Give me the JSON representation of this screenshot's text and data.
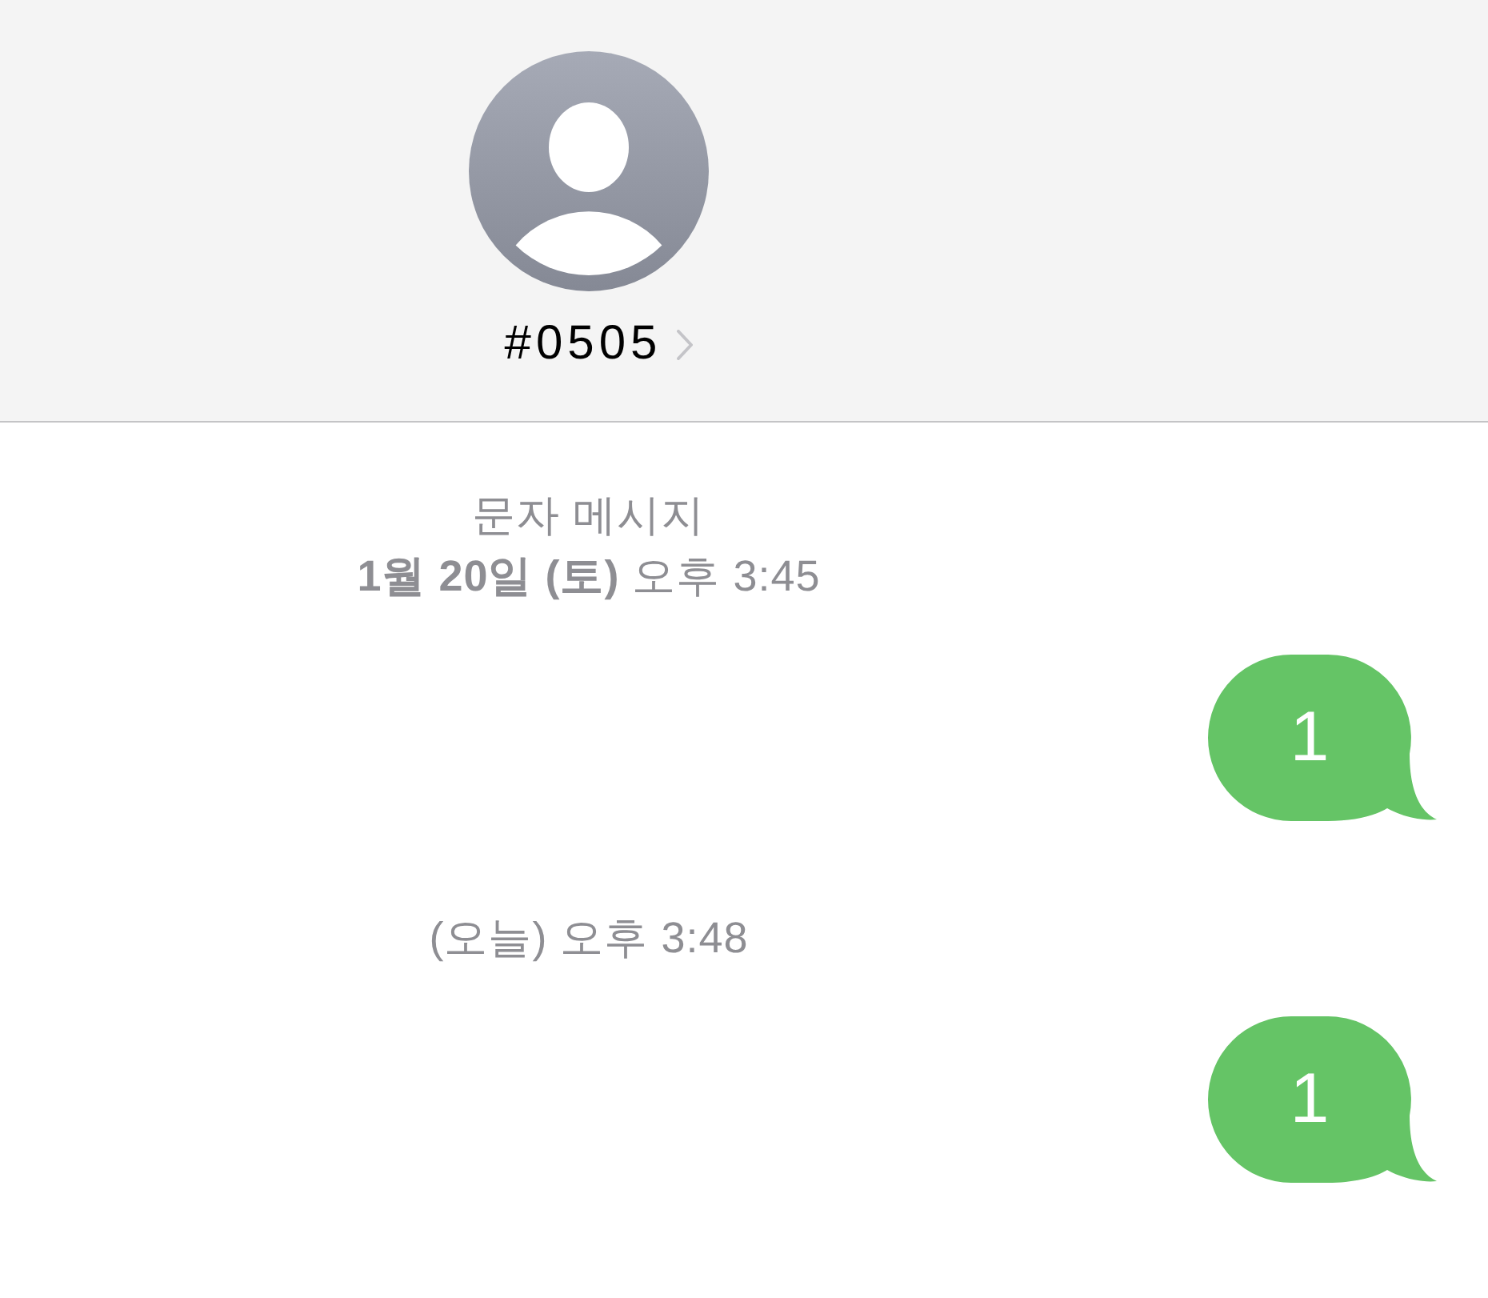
{
  "contact": {
    "name": "#0505"
  },
  "messages": [
    {
      "kind": "timestamp",
      "label": "문자 메시지",
      "time": "**1월 20일 (토)** 오후 3:45"
    },
    {
      "kind": "sent",
      "text": "1"
    },
    {
      "kind": "timestamp",
      "time": "(오늘) 오후 3:48"
    },
    {
      "kind": "sent",
      "text": "1"
    }
  ]
}
